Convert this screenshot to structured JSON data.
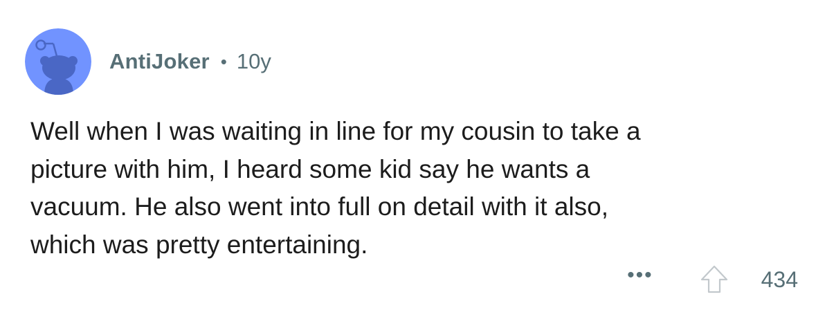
{
  "comment": {
    "author": "AntiJoker",
    "separator": "•",
    "age": "10y",
    "lines": [
      "Well when I was waiting in line for my cousin to take a",
      "picture with him, I heard some kid say he wants a",
      "vacuum. He also went into full on detail with it also,",
      "which was pretty entertaining."
    ],
    "more_label": "•••",
    "score": "434"
  },
  "colors": {
    "avatar_bg": "#7193ff",
    "avatar_figure": "#4a67c5",
    "meta_text": "#576f76",
    "body_text": "#1c1c1c",
    "upvote_outline": "#c2c8cc"
  },
  "icons": {
    "avatar": "reddit-snoo-avatar-icon",
    "more": "ellipsis-icon",
    "upvote": "upvote-arrow-icon"
  }
}
